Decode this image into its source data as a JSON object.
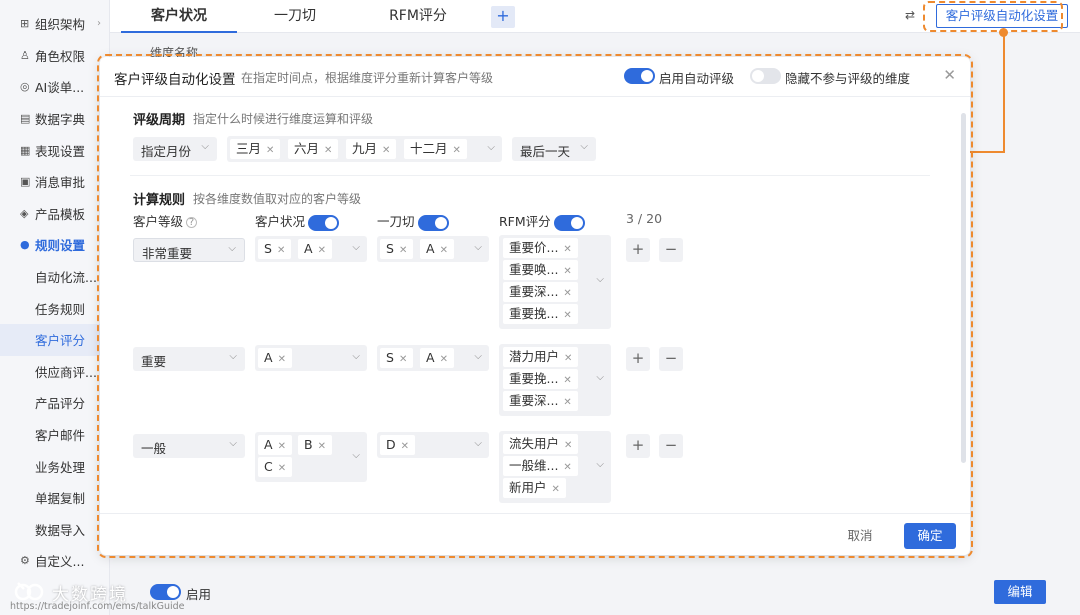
{
  "sidebar": {
    "items": [
      {
        "label": "组织架构",
        "icon": "org-icon"
      },
      {
        "label": "角色权限",
        "icon": "role-icon"
      },
      {
        "label": "AI谈单...",
        "icon": "ai-icon"
      },
      {
        "label": "数据字典",
        "icon": "dictionary-icon"
      },
      {
        "label": "表现设置",
        "icon": "display-settings-icon"
      },
      {
        "label": "消息审批",
        "icon": "approval-icon"
      },
      {
        "label": "产品模板",
        "icon": "template-icon"
      },
      {
        "label": "规则设置",
        "icon": "rules-icon"
      },
      {
        "label": "自动化流..."
      },
      {
        "label": "任务规则"
      },
      {
        "label": "客户评分"
      },
      {
        "label": "供应商评..."
      },
      {
        "label": "产品评分"
      },
      {
        "label": "客户邮件"
      },
      {
        "label": "业务处理"
      },
      {
        "label": "单据复制"
      },
      {
        "label": "数据导入"
      },
      {
        "label": "自定义...",
        "icon": "custom-icon"
      }
    ]
  },
  "tabs": [
    "客户状况",
    "一刀切",
    "RFM评分"
  ],
  "tab_add": "+",
  "peek_text": "维度名称",
  "auto_rating_button": "客户评级自动化设置",
  "modal": {
    "title": "客户评级自动化设置",
    "subtitle": "在指定时间点，根据维度评分重新计算客户等级",
    "enable_auto_label": "启用自动评级",
    "hide_dims_label": "隐藏不参与评级的维度",
    "period": {
      "title": "评级周期",
      "desc": "指定什么时候进行维度运算和评级",
      "mode": "指定月份",
      "months": [
        "三月",
        "六月",
        "九月",
        "十二月"
      ],
      "day": "最后一天"
    },
    "rules": {
      "title": "计算规则",
      "desc": "按各维度数值取对应的客户等级",
      "col_level": "客户等级",
      "col_status": "客户状况",
      "col_cut": "一刀切",
      "col_rfm": "RFM评分",
      "count": "3 / 20",
      "rows": [
        {
          "level": "非常重要",
          "status": [
            "S",
            "A"
          ],
          "cut": [
            "S",
            "A"
          ],
          "rfm": [
            "重要价...",
            "重要唤...",
            "重要深...",
            "重要挽..."
          ]
        },
        {
          "level": "重要",
          "status": [
            "A"
          ],
          "cut": [
            "S",
            "A"
          ],
          "rfm": [
            "潜力用户",
            "重要挽...",
            "重要深..."
          ]
        },
        {
          "level": "一般",
          "status": [
            "A",
            "B",
            "C"
          ],
          "cut": [
            "D"
          ],
          "rfm": [
            "流失用户",
            "一般维...",
            "新用户"
          ]
        }
      ]
    },
    "cancel_label": "取消",
    "ok_label": "确定"
  },
  "bottom": {
    "watermark_text": "大数跨境",
    "watermark_url": "https://tradejoinf.com/ems/talkGuide",
    "enable_label": "启用",
    "edit_label": "编辑"
  },
  "colors": {
    "accent": "#2f6bdc",
    "highlight": "#ee8a2f"
  }
}
